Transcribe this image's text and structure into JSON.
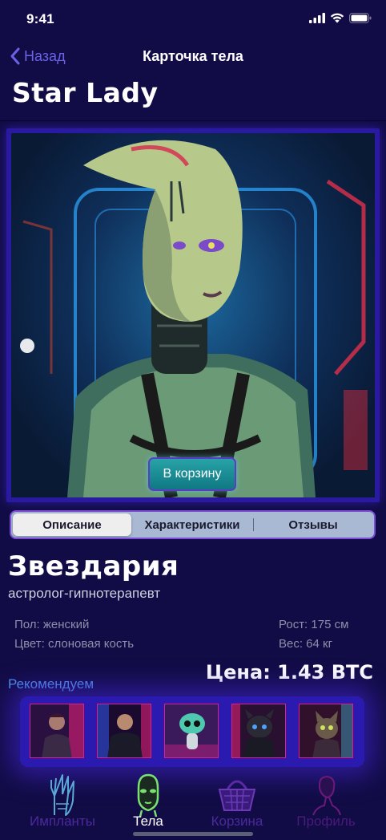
{
  "status": {
    "time": "9:41"
  },
  "nav": {
    "back_label": "Назад",
    "title": "Карточка тела"
  },
  "page_title": "Star Lady",
  "hero": {
    "cart_button": "В корзину"
  },
  "tabs": [
    {
      "label": "Описание",
      "active": true
    },
    {
      "label": "Характеристики",
      "active": false
    },
    {
      "label": "Отзывы",
      "active": false
    }
  ],
  "body": {
    "name": "Звездария",
    "role": "астролог-гипнотерапевт",
    "gender": "Пол: женский",
    "color": "Цвет: слоновая кость",
    "height": "Рост: 175 см",
    "weight": "Вес: 64 кг",
    "price": "Цена: 1.43 BTC"
  },
  "recommend": {
    "title": "Рекомендуем",
    "items": [
      "cyber-woman",
      "cyber-man",
      "alien-creature",
      "robot-dog",
      "cyber-cat"
    ]
  },
  "tabbar": [
    {
      "label": "Импланты",
      "icon": "hand-icon",
      "active": false
    },
    {
      "label": "Тела",
      "icon": "head-icon",
      "active": true
    },
    {
      "label": "Корзина",
      "icon": "basket-icon",
      "active": false
    },
    {
      "label": "Профиль",
      "icon": "profile-icon",
      "active": false
    }
  ],
  "colors": {
    "background": "#120c46",
    "accent": "#6b62e6",
    "price_link": "#4f8fe8",
    "tab_active": "#ffffff",
    "tab_inactive": "#5a2aa0"
  }
}
